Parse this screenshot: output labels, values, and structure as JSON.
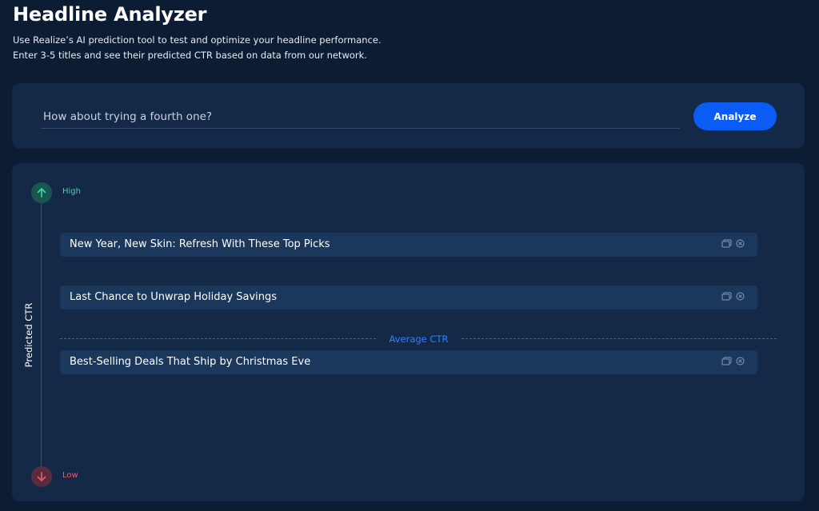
{
  "header": {
    "title": "Headline Analyzer",
    "subtitle_line1": "Use Realize’s AI prediction tool to test and optimize your headline performance.",
    "subtitle_line2": "Enter 3-5 titles and see their predicted CTR based on data from our network."
  },
  "input": {
    "placeholder": "How about trying a fourth one?",
    "value": "",
    "analyze_label": "Analyze"
  },
  "chart": {
    "axis_title": "Predicted CTR",
    "high_label": "High",
    "low_label": "Low",
    "average_label": "Average CTR",
    "colors": {
      "high": "#3fd7a3",
      "low": "#e85e6e",
      "average": "#2e82ff",
      "accent": "#0b5cf5"
    },
    "headlines": [
      {
        "text": "New Year, New Skin: Refresh With These Top Picks",
        "icons": [
          "copy-icon",
          "remove-icon"
        ]
      },
      {
        "text": "Last Chance to Unwrap Holiday Savings",
        "icons": [
          "copy-icon",
          "remove-icon"
        ]
      },
      {
        "text": "Best-Selling Deals That Ship by Christmas Eve",
        "icons": [
          "copy-icon",
          "remove-icon"
        ]
      }
    ]
  }
}
